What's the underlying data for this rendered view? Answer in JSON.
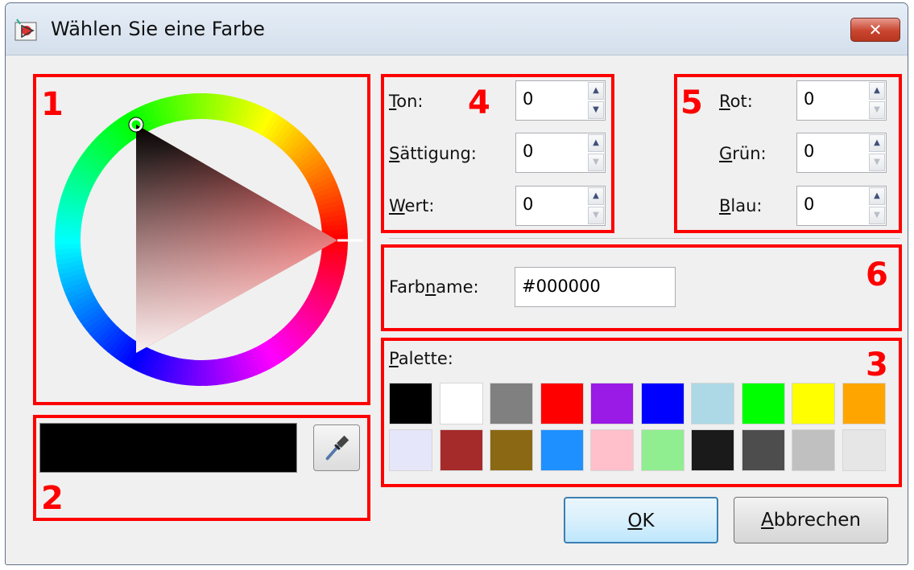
{
  "window": {
    "title": "Wählen Sie eine Farbe",
    "close_label": "✕"
  },
  "annotations": [
    "1",
    "2",
    "3",
    "4",
    "5",
    "6"
  ],
  "hsv": {
    "ton": {
      "pre": "",
      "key": "T",
      "post": "on:",
      "value": "0"
    },
    "saettigung": {
      "pre": "",
      "key": "S",
      "post": "ättigung:",
      "value": "0"
    },
    "wert": {
      "pre": "",
      "key": "W",
      "post": "ert:",
      "value": "0"
    }
  },
  "rgb": {
    "rot": {
      "pre": "",
      "key": "R",
      "post": "ot:",
      "value": "0"
    },
    "gruen": {
      "pre": "",
      "key": "G",
      "post": "rün:",
      "value": "0"
    },
    "blau": {
      "pre": "",
      "key": "B",
      "post": "lau:",
      "value": "0"
    }
  },
  "farbname": {
    "pre": "Farb",
    "key": "n",
    "post": "ame:",
    "value": "#000000"
  },
  "palette": {
    "pre": "",
    "key": "P",
    "post": "alette:",
    "colors": [
      "#000000",
      "#ffffff",
      "#808080",
      "#ff0000",
      "#9a1ae6",
      "#0000ff",
      "#add8e6",
      "#00ff00",
      "#ffff00",
      "#ffa500",
      "#e6e6fa",
      "#a52a2a",
      "#8b6914",
      "#1e90ff",
      "#ffc0cb",
      "#90ee90",
      "#1a1a1a",
      "#4d4d4d",
      "#c0c0c0",
      "#e6e6e6"
    ]
  },
  "current_color": "#000000",
  "buttons": {
    "ok": {
      "pre": "",
      "key": "O",
      "post": "K"
    },
    "cancel": {
      "pre": "",
      "key": "A",
      "post": "bbrechen"
    }
  },
  "icons": {
    "app": "color-picker-app-icon",
    "eyedropper": "eyedropper-icon"
  }
}
